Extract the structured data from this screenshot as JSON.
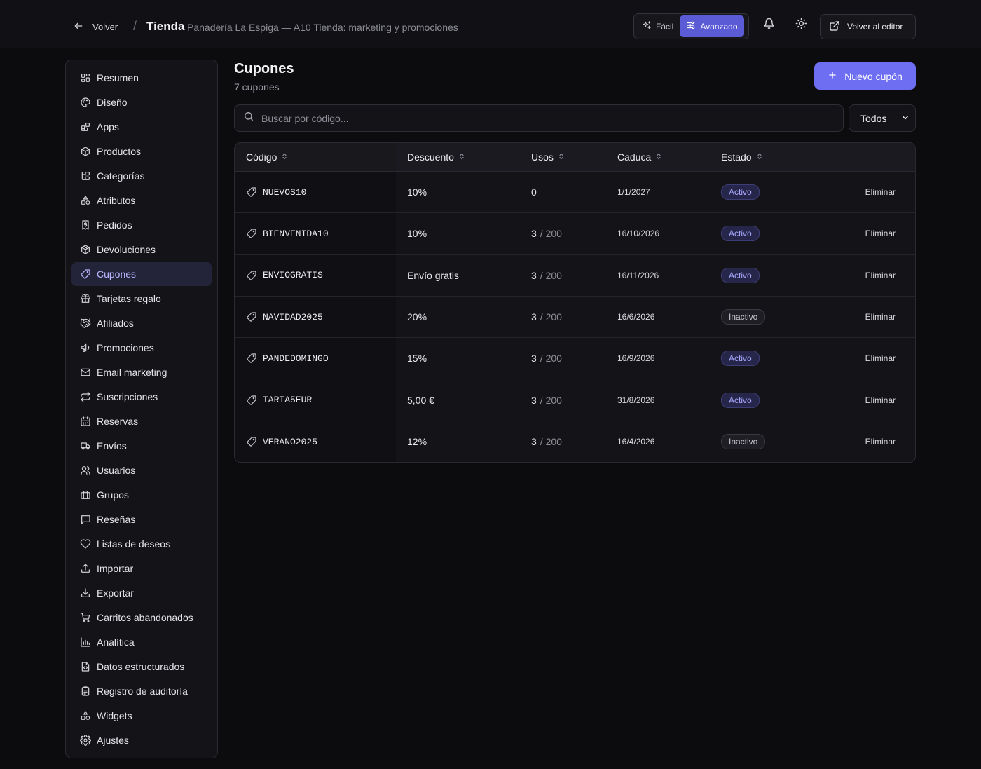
{
  "header": {
    "back_label": "Volver",
    "separator": "/",
    "title": "Tienda",
    "subtitle": "Panadería La Espiga — A10 Tienda: marketing y promociones",
    "mode_easy": "Fácil",
    "mode_advanced": "Avanzado",
    "editor_label": "Volver al editor"
  },
  "sidebar": {
    "items": [
      {
        "label": "Resumen",
        "icon": "dashboard-icon"
      },
      {
        "label": "Diseño",
        "icon": "palette-icon"
      },
      {
        "label": "Apps",
        "icon": "apps-icon"
      },
      {
        "label": "Productos",
        "icon": "box-icon"
      },
      {
        "label": "Categorías",
        "icon": "category-icon"
      },
      {
        "label": "Atributos",
        "icon": "shapes-icon"
      },
      {
        "label": "Pedidos",
        "icon": "receipt-icon"
      },
      {
        "label": "Devoluciones",
        "icon": "box-return-icon"
      },
      {
        "label": "Cupones",
        "icon": "tag-icon",
        "active": true
      },
      {
        "label": "Tarjetas regalo",
        "icon": "gift-icon"
      },
      {
        "label": "Afiliados",
        "icon": "handshake-icon"
      },
      {
        "label": "Promociones",
        "icon": "megaphone-icon"
      },
      {
        "label": "Email marketing",
        "icon": "mail-icon"
      },
      {
        "label": "Suscripciones",
        "icon": "repeat-icon"
      },
      {
        "label": "Reservas",
        "icon": "calendar-icon"
      },
      {
        "label": "Envíos",
        "icon": "truck-icon"
      },
      {
        "label": "Usuarios",
        "icon": "users-icon"
      },
      {
        "label": "Grupos",
        "icon": "group-icon"
      },
      {
        "label": "Reseñas",
        "icon": "message-icon"
      },
      {
        "label": "Listas de deseos",
        "icon": "heart-icon"
      },
      {
        "label": "Importar",
        "icon": "upload-icon"
      },
      {
        "label": "Exportar",
        "icon": "download-icon"
      },
      {
        "label": "Carritos abandonados",
        "icon": "cart-icon"
      },
      {
        "label": "Analítica",
        "icon": "bar-chart-icon"
      },
      {
        "label": "Datos estructurados",
        "icon": "file-code-icon"
      },
      {
        "label": "Registro de auditoría",
        "icon": "clipboard-icon"
      },
      {
        "label": "Widgets",
        "icon": "widgets-icon"
      },
      {
        "label": "Ajustes",
        "icon": "gear-icon"
      }
    ]
  },
  "main": {
    "title": "Cupones",
    "count": "7 cupones",
    "new_button": "Nuevo cupón",
    "search_placeholder": "Buscar por código...",
    "filter_value": "Todos",
    "columns": [
      "Código",
      "Descuento",
      "Usos",
      "Caduca",
      "Estado"
    ],
    "rows": [
      {
        "code": "NUEVOS10",
        "discount": "10%",
        "uses": "0",
        "limit": "",
        "expires": "1/1/2027",
        "status": "Activo",
        "active": true,
        "action": "Eliminar"
      },
      {
        "code": "BIENVENIDA10",
        "discount": "10%",
        "uses": "3",
        "limit": "/ 200",
        "expires": "16/10/2026",
        "status": "Activo",
        "active": true,
        "action": "Eliminar"
      },
      {
        "code": "ENVIOGRATIS",
        "discount": "Envío gratis",
        "uses": "3",
        "limit": "/ 200",
        "expires": "16/11/2026",
        "status": "Activo",
        "active": true,
        "action": "Eliminar"
      },
      {
        "code": "NAVIDAD2025",
        "discount": "20%",
        "uses": "3",
        "limit": "/ 200",
        "expires": "16/6/2026",
        "status": "Inactivo",
        "active": false,
        "action": "Eliminar"
      },
      {
        "code": "PANDEDOMINGO",
        "discount": "15%",
        "uses": "3",
        "limit": "/ 200",
        "expires": "16/9/2026",
        "status": "Activo",
        "active": true,
        "action": "Eliminar"
      },
      {
        "code": "TARTA5EUR",
        "discount": "5,00 €",
        "uses": "3",
        "limit": "/ 200",
        "expires": "31/8/2026",
        "status": "Activo",
        "active": true,
        "action": "Eliminar"
      },
      {
        "code": "VERANO2025",
        "discount": "12%",
        "uses": "3",
        "limit": "/ 200",
        "expires": "16/4/2026",
        "status": "Inactivo",
        "active": false,
        "action": "Eliminar"
      }
    ]
  },
  "colors": {
    "accent": "#6e6ef2",
    "toggle_active": "#5b5bd6",
    "background": "#0c0c0f",
    "active_badge": "#a9a9ff"
  }
}
